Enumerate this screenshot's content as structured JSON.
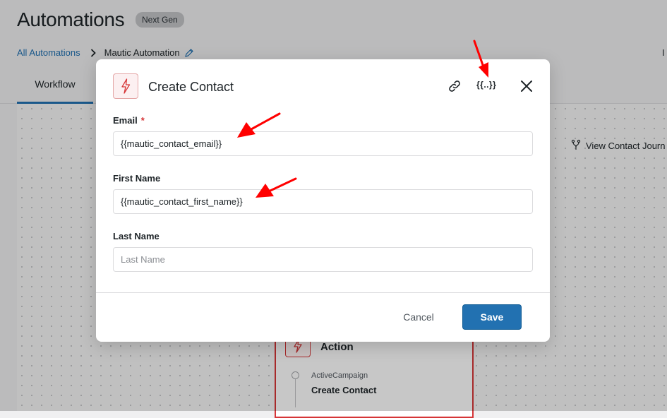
{
  "page": {
    "title": "Automations",
    "badge": "Next Gen",
    "right_cut_text": "I"
  },
  "breadcrumb": {
    "root": "All Automations",
    "current": "Mautic Automation"
  },
  "tabs": [
    {
      "label": "Workflow",
      "active": true
    }
  ],
  "canvas": {
    "journey_label": "View Contact Journ",
    "action_card": {
      "title": "Action",
      "provider": "ActiveCampaign",
      "name": "Create Contact"
    }
  },
  "modal": {
    "title": "Create Contact",
    "merge_tag_label": "{{..}}",
    "fields": [
      {
        "label": "Email",
        "required": true,
        "value": "{{mautic_contact_email}}",
        "placeholder": ""
      },
      {
        "label": "First Name",
        "required": false,
        "value": "{{mautic_contact_first_name}}",
        "placeholder": ""
      },
      {
        "label": "Last Name",
        "required": false,
        "value": "",
        "placeholder": "Last Name"
      }
    ],
    "required_marker": "*",
    "cancel_label": "Cancel",
    "save_label": "Save"
  },
  "icons": {
    "modal_icon": "lightning-icon",
    "link": "link-icon",
    "close": "close-icon",
    "journey": "branch-icon",
    "edit": "pencil-icon",
    "breadcrumb_sep": "chevron-right-icon"
  },
  "colors": {
    "accent": "#2271b1",
    "danger": "#d63638",
    "annotation_arrow": "#ff0000"
  }
}
